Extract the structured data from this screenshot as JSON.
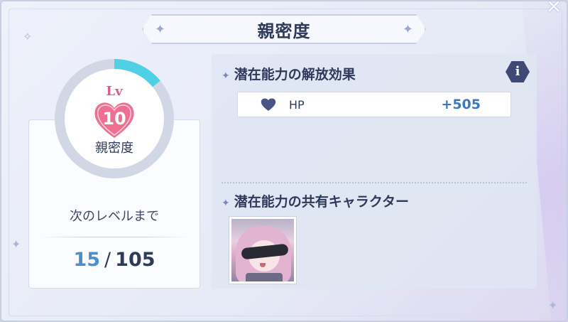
{
  "title": "親密度",
  "close_glyph": "×",
  "level": {
    "lv_label": "Lv",
    "value": "10",
    "label": "親密度",
    "progress_fraction": 0.14
  },
  "next_level": {
    "label": "次のレベルまで",
    "current": "15",
    "separator": "/",
    "required": "105"
  },
  "potential_effect": {
    "heading": "潜在能力の解放効果",
    "info_glyph": "i",
    "stats": [
      {
        "icon": "heart-icon",
        "name": "HP",
        "value": "+505"
      }
    ]
  },
  "shared_characters": {
    "heading": "潜在能力の共有キャラクター"
  },
  "colors": {
    "ring_fill": "#4fd0e4",
    "ring_track": "#d2d7e6",
    "heart": "#ef6f93",
    "accent_value": "#3c78b8",
    "info_button": "#3e4a75"
  },
  "icons": [
    "sparkle-icon",
    "heart-icon",
    "info-icon",
    "close-icon",
    "star-bullet-icon"
  ]
}
